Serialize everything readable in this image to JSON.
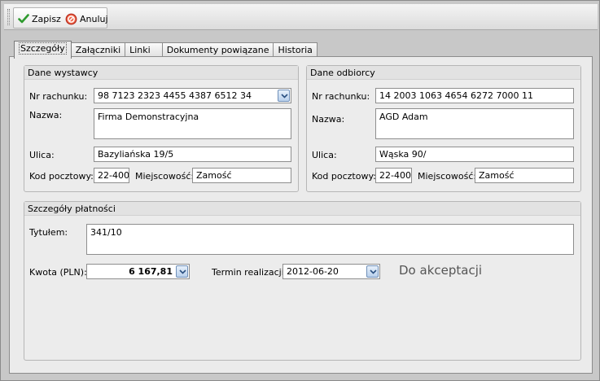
{
  "toolbar": {
    "save_label": "Zapisz",
    "cancel_label": "Anuluj"
  },
  "tabs": [
    {
      "label": "Szczegóły",
      "active": true
    },
    {
      "label": "Załączniki",
      "active": false
    },
    {
      "label": "Linki",
      "active": false
    },
    {
      "label": "Dokumenty powiązane",
      "active": false
    },
    {
      "label": "Historia",
      "active": false
    }
  ],
  "issuer": {
    "title": "Dane wystawcy",
    "account_label": "Nr rachunku:",
    "account_value": "98 7123 2323 4455 4387 6512 34",
    "name_label": "Nazwa:",
    "name_value": "Firma Demonstracyjna",
    "street_label": "Ulica:",
    "street_value": "Bazyliańska 19/5",
    "postal_label": "Kod pocztowy:",
    "postal_value": "22-400",
    "city_label": "Miejscowość:",
    "city_value": "Zamość"
  },
  "recipient": {
    "title": "Dane odbiorcy",
    "account_label": "Nr rachunku:",
    "account_value": "14 2003 1063 4654 6272 7000 11",
    "name_label": "Nazwa:",
    "name_value": "AGD Adam",
    "street_label": "Ulica:",
    "street_value": "Wąska 90/",
    "postal_label": "Kod pocztowy:",
    "postal_value": "22-400",
    "city_label": "Miejscowość:",
    "city_value": "Zamość"
  },
  "payment": {
    "title": "Szczegóły płatności",
    "subject_label": "Tytułem:",
    "subject_value": "341/10",
    "amount_label": "Kwota (PLN):",
    "amount_value": "6 167,81",
    "due_label": "Termin realizacji:",
    "due_value": "2012-06-20",
    "status": "Do akceptacji"
  },
  "colors": {
    "save_icon": "#2e9a2e",
    "cancel_icon": "#d03020",
    "status_text": "#555555"
  }
}
